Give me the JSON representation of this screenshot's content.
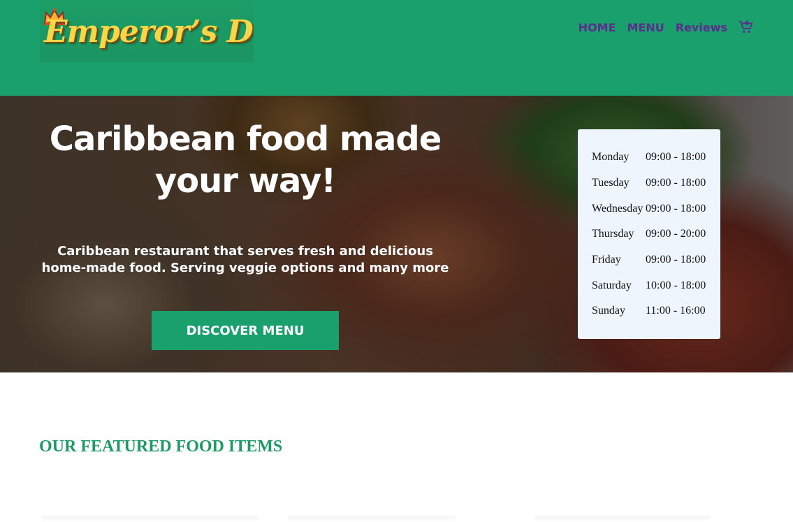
{
  "brand": {
    "name": "Emperor's Dish",
    "logo_display": "Emperor’s Dish"
  },
  "nav": {
    "items": [
      {
        "label": "HOME"
      },
      {
        "label": "MENU"
      },
      {
        "label": "Reviews"
      }
    ],
    "cart_icon": "cart-add-icon"
  },
  "hero": {
    "title_line1": "Caribbean food made",
    "title_line2": "your way!",
    "subtitle_line1": "Caribbean restaurant that serves fresh and delicious",
    "subtitle_line2": "home-made food. Serving veggie options and many more",
    "cta_label": "DISCOVER MENU"
  },
  "hours": [
    {
      "day": "Monday",
      "time": "09:00 - 18:00"
    },
    {
      "day": "Tuesday",
      "time": "09:00 - 18:00"
    },
    {
      "day": "Wednesday",
      "time": "09:00 - 18:00"
    },
    {
      "day": "Thursday",
      "time": "09:00 - 20:00"
    },
    {
      "day": "Friday",
      "time": "09:00 - 18:00"
    },
    {
      "day": "Saturday",
      "time": "10:00 - 18:00"
    },
    {
      "day": "Sunday",
      "time": "11:00 - 16:00"
    }
  ],
  "featured": {
    "title": "OUR FEATURED FOOD ITEMS"
  },
  "colors": {
    "brand_green": "#1aa06c",
    "nav_purple": "#5b2d8c",
    "logo_yellow": "#f7d64a",
    "hours_bg": "#eef5fd"
  }
}
